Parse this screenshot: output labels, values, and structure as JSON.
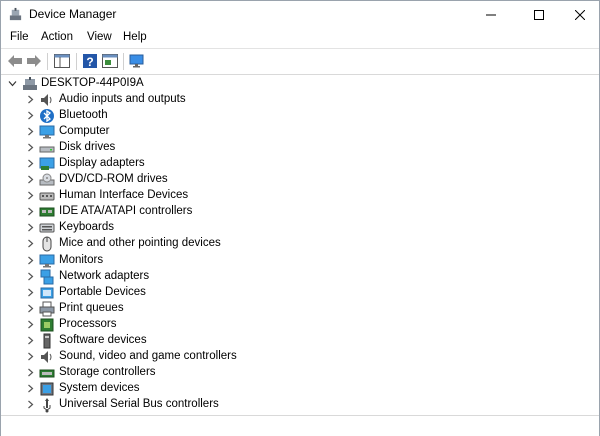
{
  "window": {
    "title": "Device Manager"
  },
  "menu": [
    "File",
    "Action",
    "View",
    "Help"
  ],
  "tree": {
    "root": "DESKTOP-44P0I9A",
    "items": [
      {
        "label": "Audio inputs and outputs",
        "icon": "speaker-icon"
      },
      {
        "label": "Bluetooth",
        "icon": "bluetooth-icon"
      },
      {
        "label": "Computer",
        "icon": "computer-icon"
      },
      {
        "label": "Disk drives",
        "icon": "disk-drive-icon"
      },
      {
        "label": "Display adapters",
        "icon": "display-adapter-icon"
      },
      {
        "label": "DVD/CD-ROM drives",
        "icon": "dvd-drive-icon"
      },
      {
        "label": "Human Interface Devices",
        "icon": "hid-icon"
      },
      {
        "label": "IDE ATA/ATAPI controllers",
        "icon": "ide-controller-icon"
      },
      {
        "label": "Keyboards",
        "icon": "keyboard-icon"
      },
      {
        "label": "Mice and other pointing devices",
        "icon": "mouse-icon"
      },
      {
        "label": "Monitors",
        "icon": "monitor-icon"
      },
      {
        "label": "Network adapters",
        "icon": "network-adapter-icon"
      },
      {
        "label": "Portable Devices",
        "icon": "portable-device-icon"
      },
      {
        "label": "Print queues",
        "icon": "printer-icon"
      },
      {
        "label": "Processors",
        "icon": "processor-icon"
      },
      {
        "label": "Software devices",
        "icon": "software-device-icon"
      },
      {
        "label": "Sound, video and game controllers",
        "icon": "sound-controller-icon"
      },
      {
        "label": "Storage controllers",
        "icon": "storage-controller-icon"
      },
      {
        "label": "System devices",
        "icon": "system-device-icon"
      },
      {
        "label": "Universal Serial Bus controllers",
        "icon": "usb-icon"
      }
    ]
  }
}
